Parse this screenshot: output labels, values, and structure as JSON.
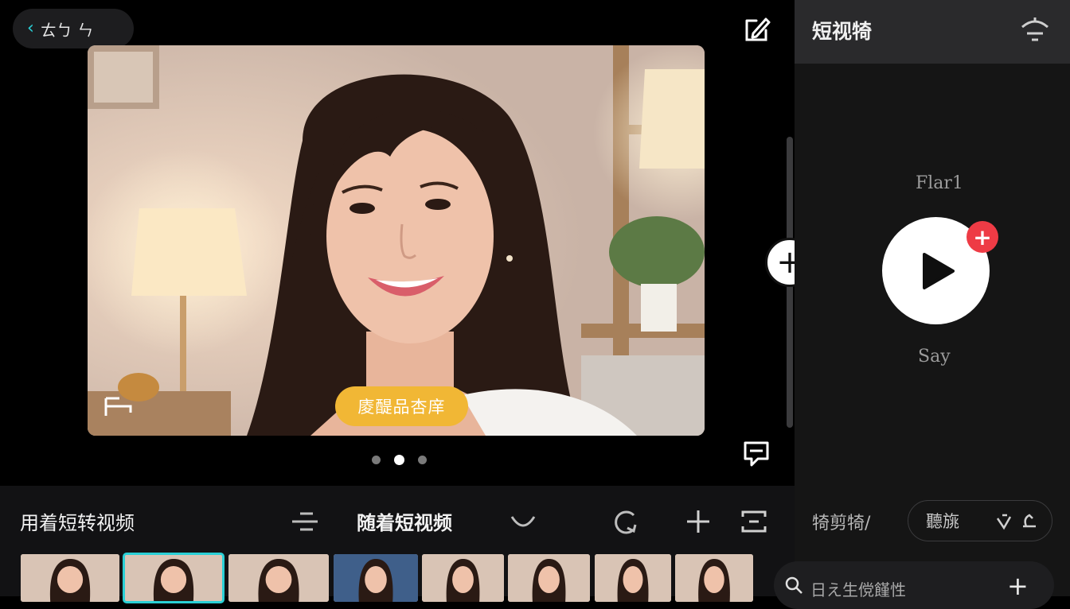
{
  "header": {
    "back_label": "ㄊㄅ ㄣ",
    "edit_icon": "edit-icon"
  },
  "preview": {
    "caption": "庱醍品杏庠",
    "page_dots": 3,
    "active_dot": 2
  },
  "right_panel": {
    "title": "短视犄",
    "track_title": "Flar1",
    "track_subtitle": "Say",
    "badge": "+"
  },
  "toolbar": {
    "left_label": "用着短转视频",
    "mid_label": "随着短视频",
    "right_label": "犄剪犄/",
    "chip_label": "聽旐",
    "search_label": "日え生傥饉性",
    "add_symbol": "+"
  },
  "thumbnails": [
    {
      "variant": "portrait",
      "selected": false
    },
    {
      "variant": "portrait",
      "selected": true
    },
    {
      "variant": "portrait",
      "selected": false
    },
    {
      "variant": "blue",
      "selected": false
    },
    {
      "variant": "portrait",
      "selected": false
    },
    {
      "variant": "portrait",
      "selected": false
    },
    {
      "variant": "portrait",
      "selected": false
    },
    {
      "variant": "portrait",
      "selected": false
    }
  ],
  "colors": {
    "accent": "#2ad0d6",
    "caption_bg": "#f1b735",
    "badge_red": "#ee3b45"
  }
}
